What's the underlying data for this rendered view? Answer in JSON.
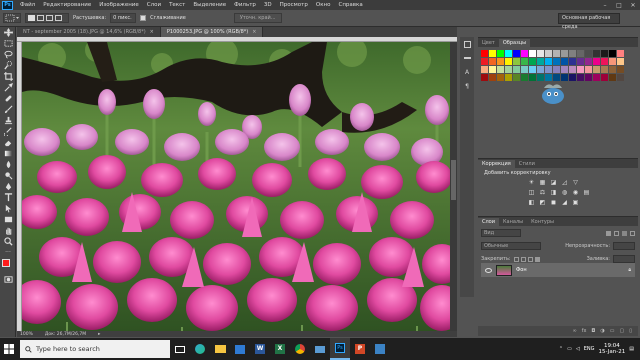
{
  "menu": {
    "logo": "Ps",
    "items": [
      "Файл",
      "Редактирование",
      "Изображение",
      "Слои",
      "Текст",
      "Выделение",
      "Фильтр",
      "3D",
      "Просмотр",
      "Окно",
      "Справка"
    ]
  },
  "options": {
    "feather_label": "Растушевка:",
    "feather_value": "0 пикс.",
    "antialias_label": "Сглаживание",
    "refine_edge": "Уточн. край...",
    "workspace": "Основная рабочая среда"
  },
  "doc_tabs": [
    {
      "label": "NT - september 2005 (18).JPG @ 14,6% (RGB/8*)",
      "active": false
    },
    {
      "label": "P1000253.JPG @ 100% (RGB/8*)",
      "active": true
    }
  ],
  "status": {
    "zoom": "100%",
    "doc_size": "Док: 26,7M/26,7M"
  },
  "swatches_panel": {
    "tabs": [
      "Цвет",
      "Образцы"
    ]
  },
  "swatch_colors": [
    "#ff0000",
    "#ffff00",
    "#00ff00",
    "#00ffff",
    "#0000ff",
    "#ff00ff",
    "#ffffff",
    "#e6e6e6",
    "#cccccc",
    "#b3b3b3",
    "#999999",
    "#808080",
    "#666666",
    "#4d4d4d",
    "#333333",
    "#1a1a1a",
    "#000000",
    "#ff8080",
    "#ed1c24",
    "#f26522",
    "#f7941d",
    "#fff200",
    "#8dc63f",
    "#39b54a",
    "#00a651",
    "#00a99d",
    "#00aeef",
    "#0072bc",
    "#0054a6",
    "#2e3192",
    "#662d91",
    "#92278f",
    "#ec008c",
    "#ed145b",
    "#f69679",
    "#fdc689",
    "#f9ad81",
    "#fff799",
    "#c4df9b",
    "#a3d39c",
    "#82ca9c",
    "#7accc8",
    "#6dcff6",
    "#7da7d9",
    "#8393ca",
    "#8781bd",
    "#a186be",
    "#bd8cbf",
    "#f49ac1",
    "#f5989d",
    "#c69c6d",
    "#a67c52",
    "#8c6239",
    "#754c24",
    "#9e0b0f",
    "#a0410d",
    "#a3620a",
    "#aba000",
    "#598527",
    "#1a7b30",
    "#007236",
    "#00746b",
    "#0076a3",
    "#004a80",
    "#003471",
    "#1b1464",
    "#440e62",
    "#630460",
    "#9e005d",
    "#9e0039",
    "#603913",
    "#534741"
  ],
  "adjustments_panel": {
    "tabs": [
      "Коррекция",
      "Стили"
    ],
    "title": "Добавить корректировку",
    "row1": [
      "☀",
      "▦",
      "◪",
      "◿",
      "▽"
    ],
    "row2": [
      "◫",
      "⚖",
      "◨",
      "◍",
      "◉",
      "▤"
    ],
    "row3": [
      "◧",
      "◩",
      "◼",
      "◢",
      "▣"
    ]
  },
  "layers_panel": {
    "tabs": [
      "Слои",
      "Каналы",
      "Контуры"
    ],
    "filter": "Вид",
    "blend_mode": "Обычные",
    "opacity_label": "Непрозрачность:",
    "lock_label": "Закрепить:",
    "fill_label": "Заливка:",
    "layer_name": "Фон"
  },
  "taskbar": {
    "search_placeholder": "Type here to search",
    "time": "19:04",
    "date": "15-Jan-21",
    "lang": "ENG"
  }
}
